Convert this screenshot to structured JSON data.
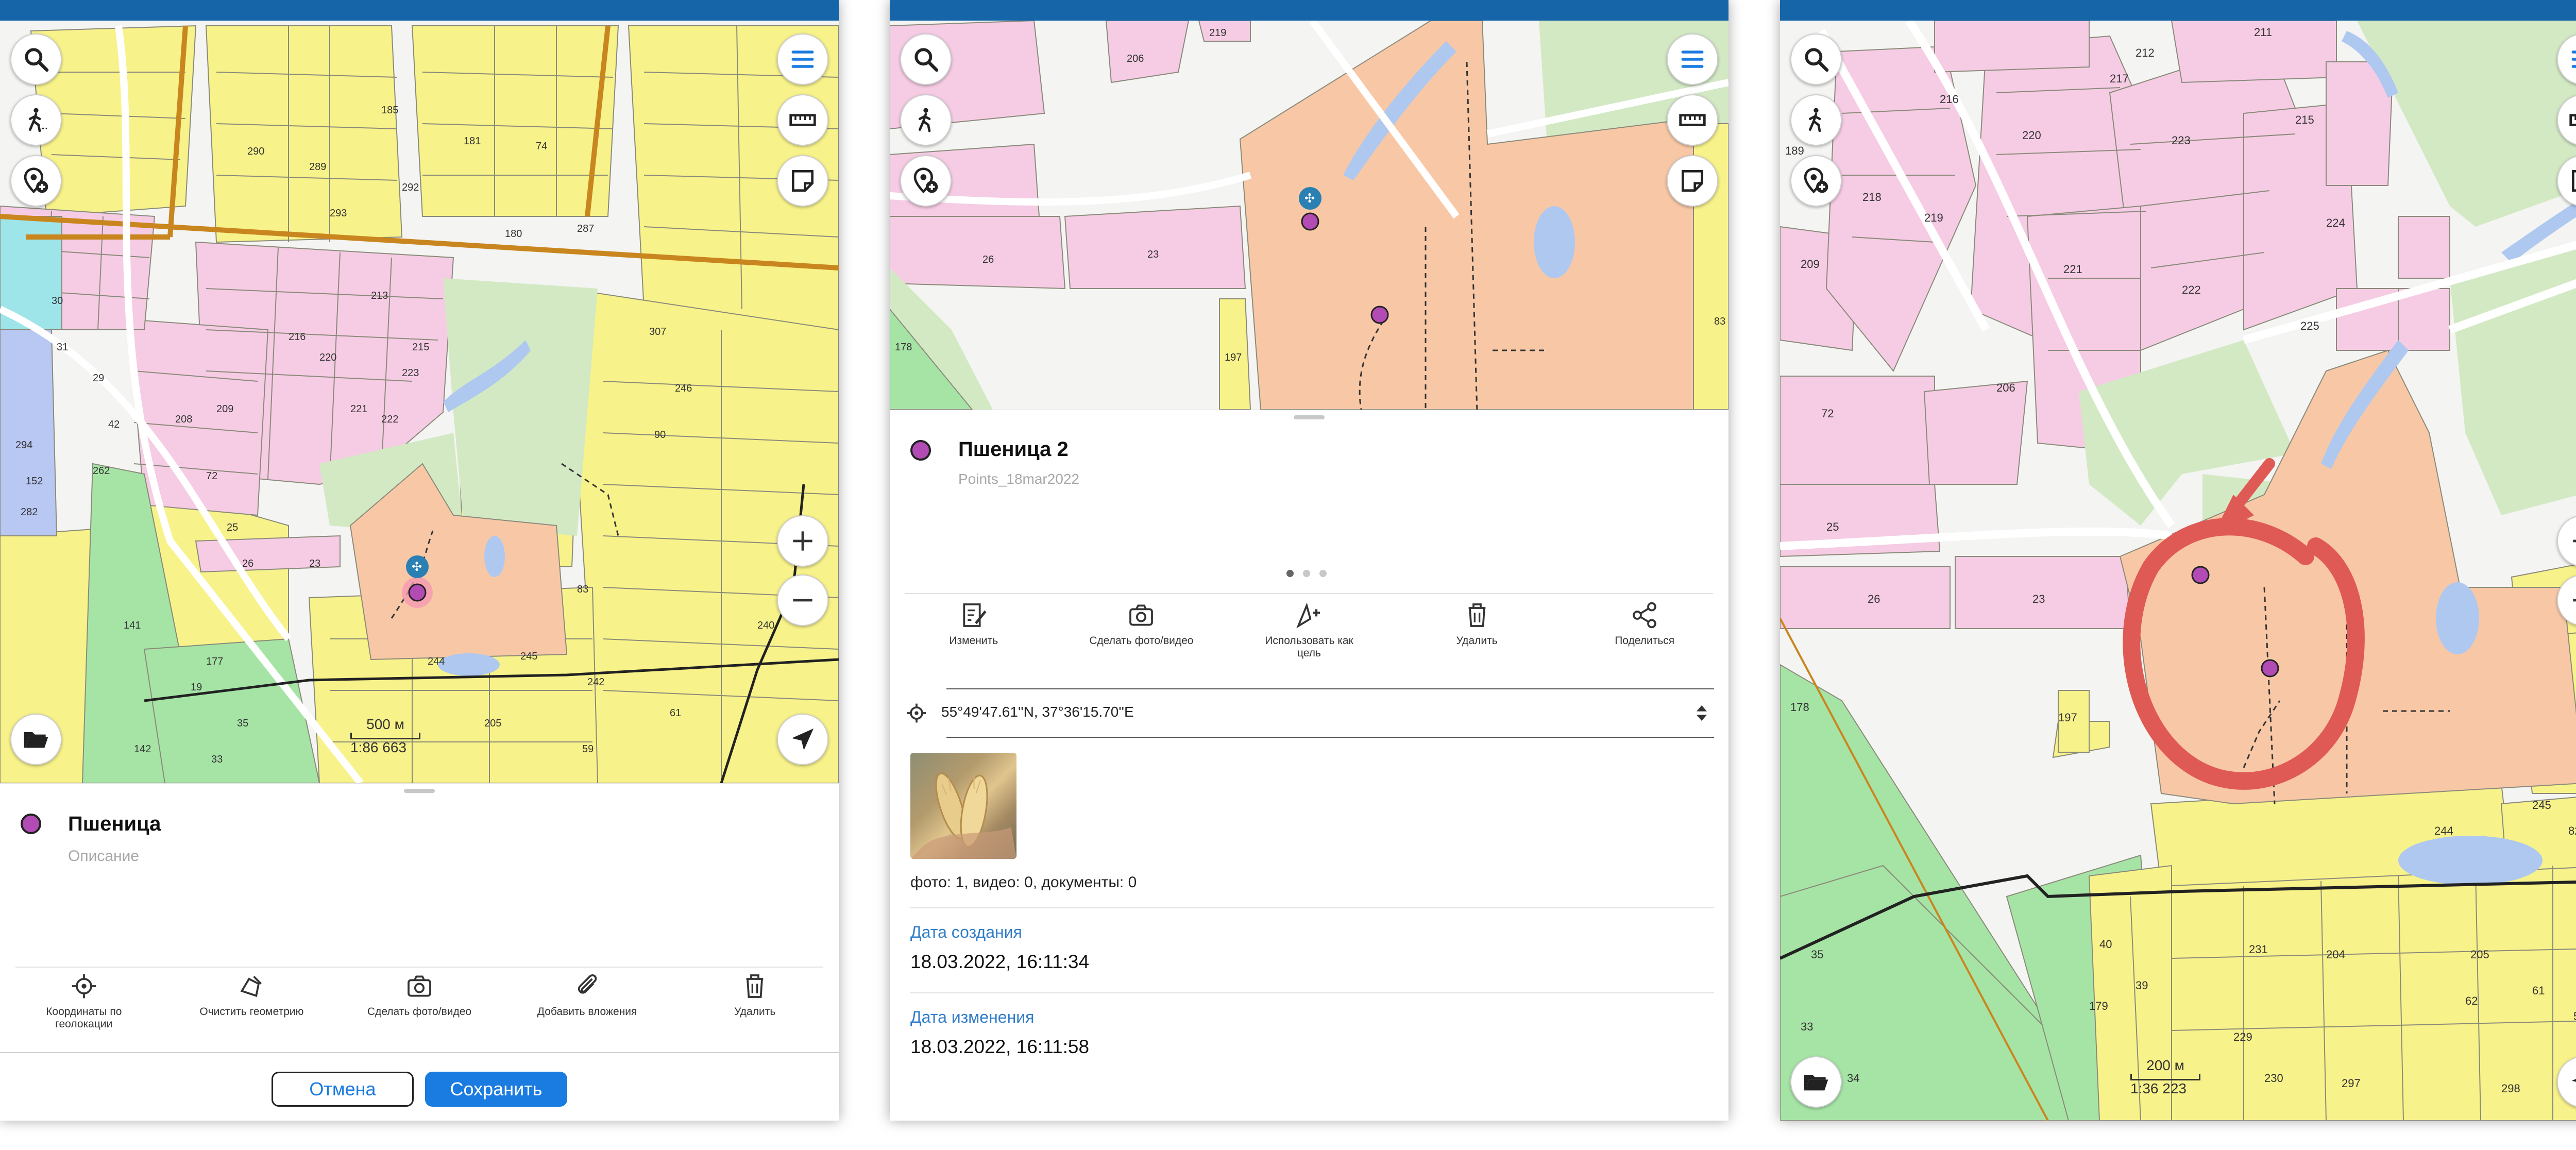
{
  "panel1": {
    "scale": {
      "distance": "500 м",
      "ratio": "1:86 663"
    },
    "feature": {
      "title": "Пшеница",
      "description_placeholder": "Описание"
    },
    "actions": [
      {
        "label": "Координаты по геолокации",
        "icon": "gps-icon"
      },
      {
        "label": "Очистить геометрию",
        "icon": "clear-geometry-icon"
      },
      {
        "label": "Сделать фото/видео",
        "icon": "camera-icon"
      },
      {
        "label": "Добавить вложения",
        "icon": "paperclip-icon"
      },
      {
        "label": "Удалить",
        "icon": "trash-icon"
      }
    ],
    "cancel_label": "Отмена",
    "save_label": "Сохранить"
  },
  "panel2": {
    "feature": {
      "title": "Пшеница 2",
      "layer": "Points_18mar2022"
    },
    "actions": [
      {
        "label": "Изменить",
        "icon": "edit-icon"
      },
      {
        "label": "Сделать фото/видео",
        "icon": "camera-icon"
      },
      {
        "label": "Использовать как цель",
        "icon": "navigate-target-icon"
      },
      {
        "label": "Удалить",
        "icon": "trash-icon"
      },
      {
        "label": "Поделиться",
        "icon": "share-icon"
      }
    ],
    "coordinates": "55°49'47.61''N, 37°36'15.70''E",
    "attachments_summary": "фото: 1, видео: 0, документы: 0",
    "created_label": "Дата создания",
    "created_value": "18.03.2022, 16:11:34",
    "modified_label": "Дата изменения",
    "modified_value": "18.03.2022, 16:11:58"
  },
  "panel3": {
    "scale": {
      "distance": "200 м",
      "ratio": "1:36 223"
    }
  },
  "colors": {
    "topbar": "#1565a8",
    "accent": "#1a7be0",
    "parcel_yellow": "#f8f28a",
    "parcel_pink": "#f6cce4",
    "parcel_green": "#a6e4a6",
    "parcel_orange": "#f8c8a6",
    "water": "#aec8f0",
    "point_fill": "#b24bb4",
    "annotation_red": "#e05a55"
  }
}
